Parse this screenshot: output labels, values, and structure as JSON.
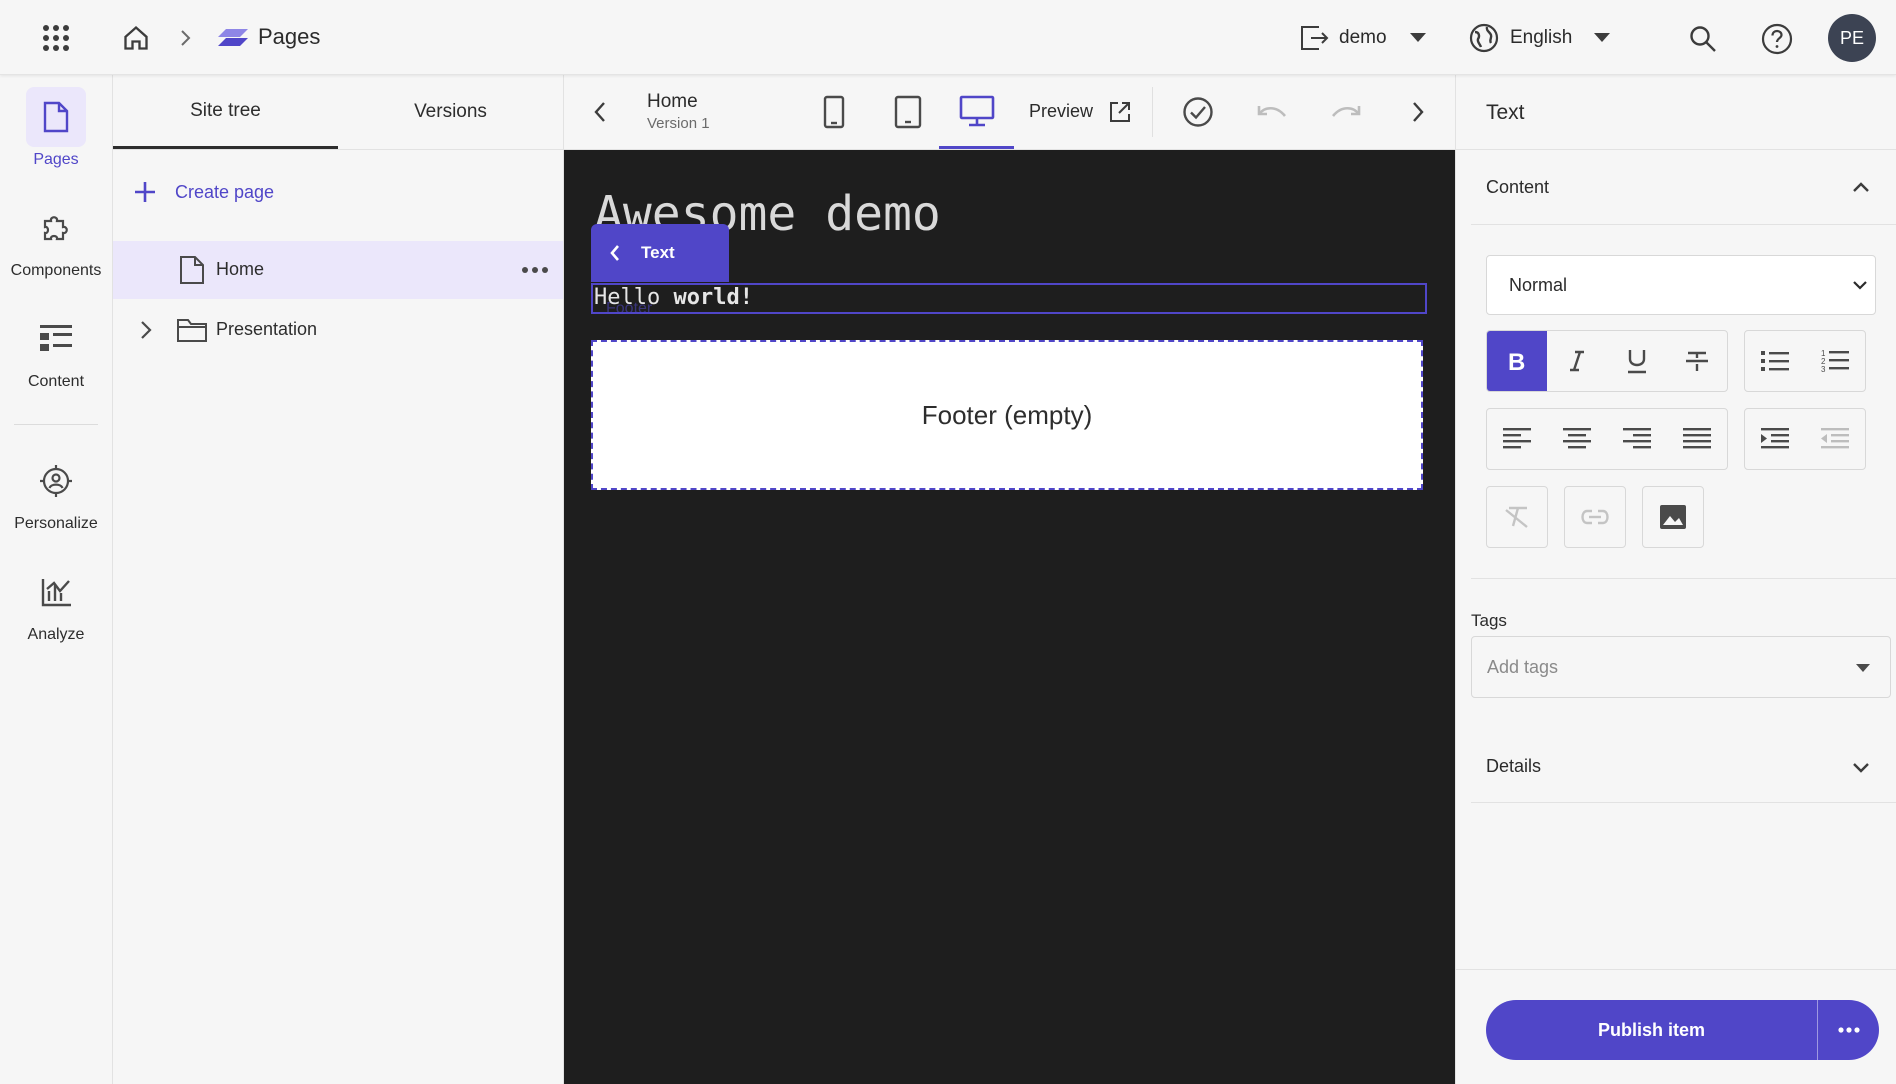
{
  "topbar": {
    "app_title": "Pages",
    "site_dropdown": "demo",
    "language_dropdown": "English",
    "avatar_initials": "PE"
  },
  "leftnav": {
    "items": [
      {
        "label": "Pages",
        "icon": "page-icon",
        "active": true
      },
      {
        "label": "Components",
        "icon": "puzzle-icon"
      },
      {
        "label": "Content",
        "icon": "content-list-icon"
      },
      {
        "label": "Personalize",
        "icon": "target-user-icon"
      },
      {
        "label": "Analyze",
        "icon": "analytics-icon"
      }
    ]
  },
  "tree": {
    "tabs": [
      "Site tree",
      "Versions"
    ],
    "active_tab": "Site tree",
    "create_page": "Create page",
    "rows": [
      {
        "label": "Home",
        "selected": true
      },
      {
        "label": "Presentation"
      }
    ]
  },
  "toolbar": {
    "page_name": "Home",
    "version": "Version 1",
    "preview_label": "Preview",
    "active_device": "desktop"
  },
  "canvas": {
    "heading": "Awesome demo",
    "chip_label": "Text",
    "hello_plain": "Hello ",
    "hello_bold": "world!",
    "footer_ghost": "Footer",
    "footer_placeholder": "Footer (empty)"
  },
  "rightpanel": {
    "title": "Text",
    "content_section": "Content",
    "style_select": "Normal",
    "tags_label": "Tags",
    "tags_placeholder": "Add tags",
    "details_section": "Details",
    "publish_label": "Publish item"
  },
  "colors": {
    "accent": "#5046c8",
    "accent_light": "#ebe7fb",
    "canvas_bg": "#1e1e1e",
    "panel_bg": "#f6f6f6"
  }
}
